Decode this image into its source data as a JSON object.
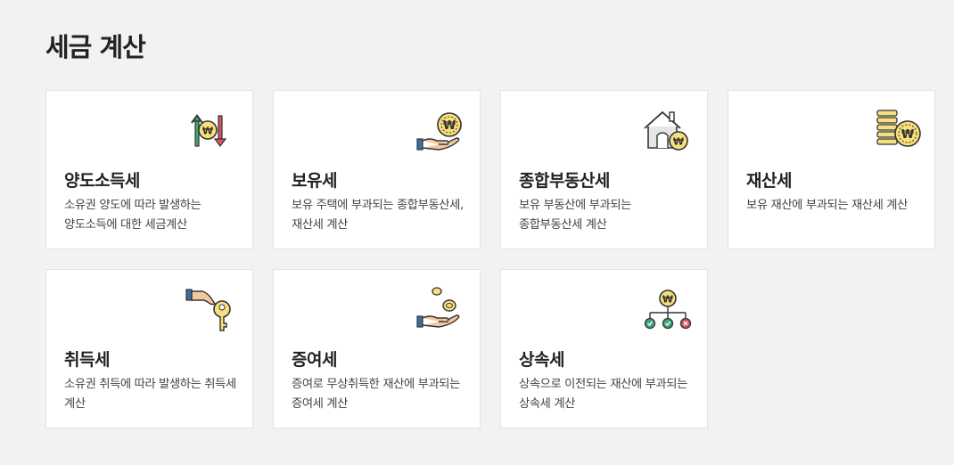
{
  "page": {
    "title": "세금 계산"
  },
  "cards": [
    {
      "title": "양도소득세",
      "desc": "소유권 양도에 따라 발생하는 양도소득에 대한 세금계산",
      "icon": "transfer-arrows-won-icon"
    },
    {
      "title": "보유세",
      "desc": "보유 주택에 부과되는 종합부동산세, 재산세 계산",
      "icon": "hand-holding-won-coin-icon"
    },
    {
      "title": "종합부동산세",
      "desc": "보유 부동산에 부과되는 종합부동산세 계산",
      "icon": "house-won-icon"
    },
    {
      "title": "재산세",
      "desc": "보유 재산에 부과되는 재산세 계산",
      "icon": "coin-stack-won-icon"
    },
    {
      "title": "취득세",
      "desc": "소유권 취득에 따라 발생하는 취득세 계산",
      "icon": "hand-key-icon"
    },
    {
      "title": "증여세",
      "desc": "증여로 무상취득한 재산에 부과되는 증여세 계산",
      "icon": "hand-giving-coins-icon"
    },
    {
      "title": "상속세",
      "desc": "상속으로 이전되는 재산에 부과되는 상속세 계산",
      "icon": "inheritance-tree-icon"
    }
  ],
  "colors": {
    "background": "#f2f2f2",
    "card": "#ffffff",
    "coin": "#f7df7a",
    "green": "#3ea677",
    "red": "#d9545e",
    "skin": "#f4c7a1",
    "blue": "#3b6fa0"
  }
}
